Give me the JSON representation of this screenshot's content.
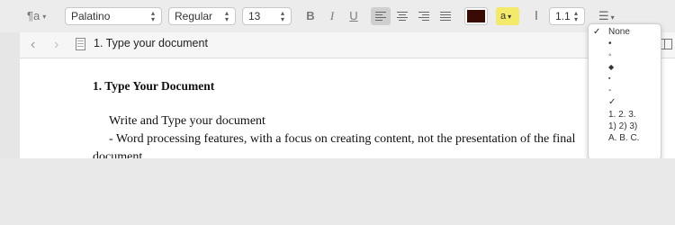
{
  "toolbar": {
    "paragraph_style_icon": "¶a",
    "font_family": "Palatino",
    "font_style": "Regular",
    "font_size": "13",
    "bold": "B",
    "italic": "I",
    "underline": "U",
    "text_color": "#3a0a05",
    "highlight_label": "a",
    "highlight_color": "#f3e96a",
    "line_spacing": "1.1"
  },
  "tab": {
    "title": "1. Type your document"
  },
  "document": {
    "heading": "1. Type Your Document",
    "lines": [
      "Write and Type your document",
      "- Word processing features, with a focus on creating content, not the presentation of the final",
      "document"
    ]
  },
  "list_menu": {
    "items": [
      {
        "check": "✓",
        "label": "None"
      },
      {
        "check": "",
        "label": "•"
      },
      {
        "check": "",
        "label": "◦"
      },
      {
        "check": "",
        "label": "◆"
      },
      {
        "check": "",
        "label": "▪"
      },
      {
        "check": "",
        "label": "-"
      },
      {
        "check": "",
        "label": "✓"
      },
      {
        "check": "",
        "label": "1.  2.  3."
      },
      {
        "check": "",
        "label": "1)  2)  3)"
      },
      {
        "check": "",
        "label": "A.  B.  C."
      }
    ]
  }
}
